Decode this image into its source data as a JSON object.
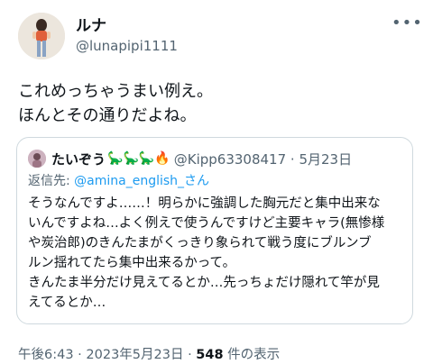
{
  "author": {
    "display_name": "ルナ",
    "handle": "@lunapipi1111"
  },
  "more_icon": "more-horizontal-icon",
  "tweet": {
    "lines": [
      "これめっちゃうまい例え。",
      "ほんとその通りだよね。"
    ]
  },
  "quote": {
    "display_name": "たいぞう",
    "name_emojis": "🦕🦕🦕🔥",
    "handle_date": "@Kipp63308417 · 5月23日",
    "reply_prefix": "返信先: ",
    "reply_to": "@amina_english_さん",
    "lines": [
      "そうなんですよ……！明らかに強調した胸元だと集中出来な",
      "いんですよね…よく例えで使うんですけど主要キャラ(無惨様",
      "や炭治郎)のきんたまがくっきり象られて戦う度にブルンブ",
      "ルン揺れてたら集中出来るかって。",
      "きんたま半分だけ見えてるとか…先っちょだけ隠れて竿が見",
      "えてるとか…"
    ]
  },
  "meta": {
    "time_date": "午後6:43 · 2023年5月23日 · ",
    "view_count": "548",
    "views_label": " 件の表示"
  },
  "colors": {
    "text": "#0f1419",
    "secondary": "#536471",
    "link": "#1d9bf0",
    "border": "#cfd9de"
  }
}
